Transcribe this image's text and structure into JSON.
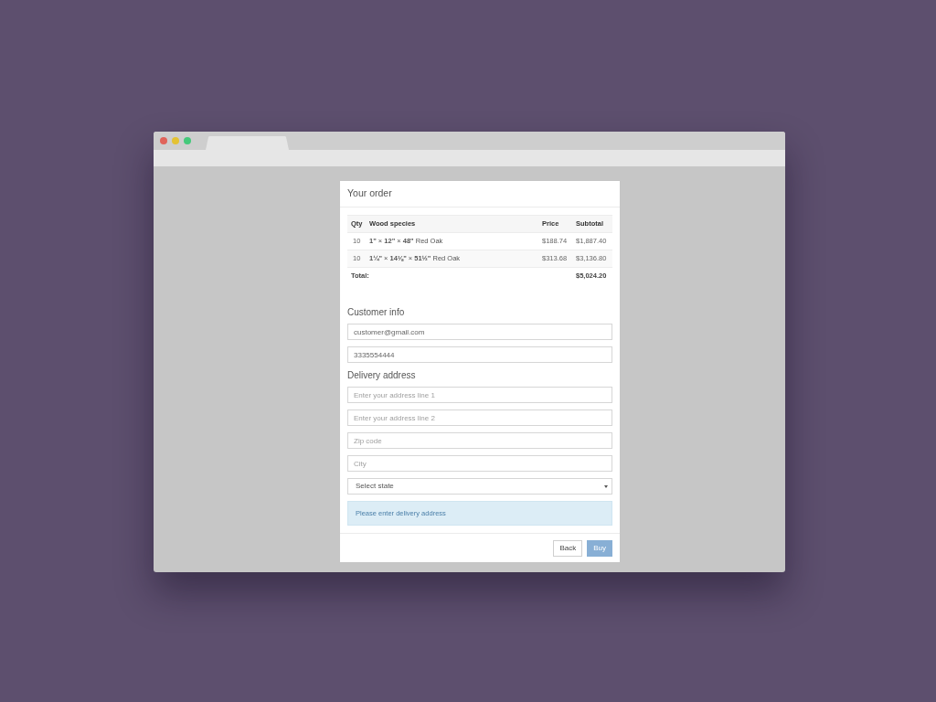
{
  "window": {
    "controls": [
      {
        "color": "#e0635a"
      },
      {
        "color": "#e4c234"
      },
      {
        "color": "#45c97b"
      }
    ]
  },
  "order": {
    "title": "Your order",
    "columns": [
      "Qty",
      "Wood species",
      "Price",
      "Subtotal"
    ],
    "rows": [
      {
        "qty": "10",
        "species": "**1\"** × **12\"** × **48\"** Red Oak",
        "price": "$188.74",
        "subtotal": "$1,887.40"
      },
      {
        "qty": "10",
        "species": "**1¼\"** × **14⅛\"** × **51½\"** Red Oak",
        "price": "$313.68",
        "subtotal": "$3,136.80"
      }
    ],
    "total": {
      "label": "Total:",
      "value": "$5,024.20"
    }
  },
  "customer_info": {
    "heading": "Customer info",
    "fields": [
      {
        "kind": "input",
        "value": "customer@gmail.com"
      },
      {
        "kind": "input",
        "value": "3335554444"
      }
    ]
  },
  "delivery_address": {
    "heading": "Delivery address",
    "fields": [
      {
        "kind": "input",
        "placeholder": "Enter your address line 1"
      },
      {
        "kind": "input",
        "placeholder": "Enter your address line 2"
      },
      {
        "kind": "input",
        "placeholder": "Zip code"
      },
      {
        "kind": "input",
        "placeholder": "City"
      },
      {
        "kind": "select",
        "value": "Select state"
      }
    ]
  },
  "alert": {
    "text": "Please enter delivery address"
  },
  "buttons": [
    {
      "label": "Back",
      "kind": "default",
      "disabled": false
    },
    {
      "label": "Buy",
      "kind": "primary",
      "disabled": true
    }
  ]
}
